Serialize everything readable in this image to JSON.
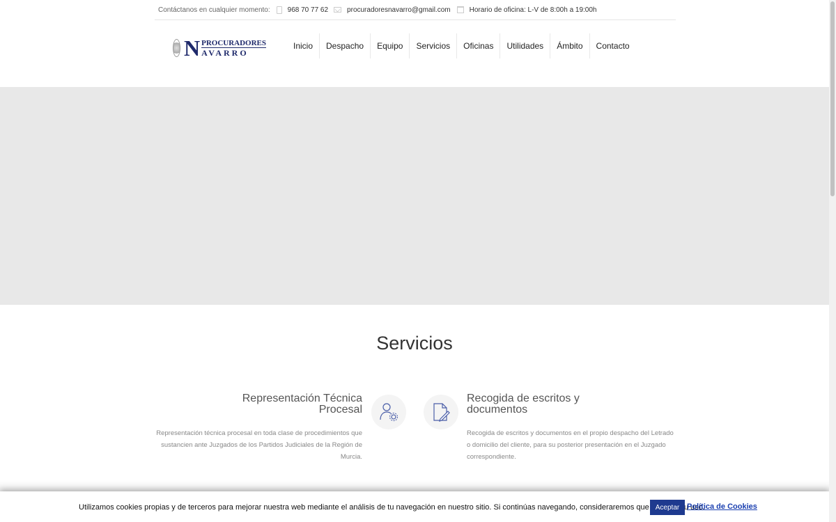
{
  "topbar": {
    "lead": "Contáctanos en cualquier momento:",
    "phone": "968 70 77 62",
    "email": "procuradoresnavarro@gmail.com",
    "hours": "Horario de oficina: L-V de 8:00h a 19:00h"
  },
  "logo": {
    "initial": "N",
    "line1": "PROCURADORES",
    "line2": "AVARRO"
  },
  "nav": [
    "Inicio",
    "Despacho",
    "Equipo",
    "Servicios",
    "Oficinas",
    "Utilidades",
    "Ámbito",
    "Contacto"
  ],
  "services": {
    "title": "Servicios",
    "left": {
      "title_line1": "Representación Técnica",
      "title_line2": "Procesal",
      "desc_line1": "Representación técnica procesal en toda clase de procedimientos que",
      "desc_line2": "sustancien ante Juzgados de los Partidos Judiciales de la Región de",
      "desc_line3": "Murcia.",
      "icon": "user-gear-icon"
    },
    "right": {
      "title_line1": "Recogida de escritos y",
      "title_line2": "documentos",
      "desc_line1": "Recogida de escritos y documentos en el propio despacho del Letrado",
      "desc_line2": "o domicilio del cliente, para su posterior presentación en el Juzgado",
      "desc_line3": "correspondiente.",
      "icon": "document-edit-icon"
    }
  },
  "cookie": {
    "message": "Utilizamos cookies propias y de terceros para mejorar nuestra web mediante el análisis de tu navegación en nuestro sitio. Si continúas navegando, consideraremos que aceptas su uso.",
    "accept": "Aceptar",
    "policy": "Política de Cookies"
  }
}
